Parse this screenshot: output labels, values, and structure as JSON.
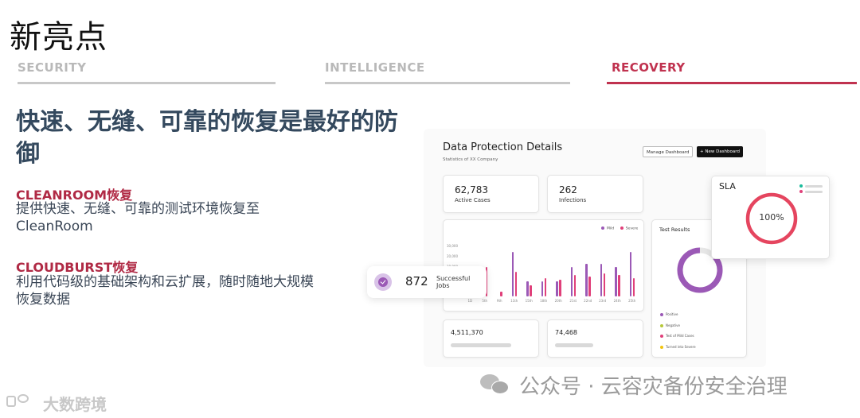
{
  "page_title": "新亮点",
  "tabs": [
    {
      "label": "SECURITY"
    },
    {
      "label": "INTELLIGENCE"
    },
    {
      "label": "RECOVERY"
    }
  ],
  "headline": "快速、无缝、可靠的恢复是最好的防御",
  "features": [
    {
      "title": "CLEANROOM恢复",
      "desc": "提供快速、无缝、可靠的测试环境恢复至CleanRoom"
    },
    {
      "title": "CLOUDBURST恢复",
      "desc": "利用代码级的基础架构和云扩展，随时随地大规模恢复数据"
    }
  ],
  "dashboard": {
    "title": "Data Protection Details",
    "subtitle": "Statistics of XX Company",
    "manage_button": "Manage Dashboard",
    "new_button": "+ New Dashboard",
    "active_cases_value": "62,783",
    "active_cases_label": "Active Cases",
    "infections_value": "262",
    "infections_label": "Infections",
    "bar_legend": [
      "Mild",
      "Severe"
    ],
    "bar_y_labels": [
      "30,000",
      "20,000",
      "10,000",
      "0"
    ],
    "bar_x_labels": [
      "1D",
      "5th",
      "9th",
      "11th",
      "15th",
      "18th",
      "20th",
      "21st",
      "22nd",
      "23rd",
      "24th",
      "25th"
    ],
    "test_results_title": "Test Results",
    "test_results_legend": [
      "Positive",
      "Negative",
      "Test of Mild Cases",
      "Turned into Severe"
    ],
    "bottom_value_1": "4,511,370",
    "bottom_value_2": "74,468",
    "sla_title": "SLA",
    "sla_value": "100%",
    "jobs_value": "872",
    "jobs_label": "Successful Jobs"
  },
  "chart_data": {
    "type": "bar",
    "categories": [
      "1D",
      "5th",
      "9th",
      "11th",
      "15th",
      "18th",
      "20th",
      "21st",
      "22nd",
      "23rd",
      "24th",
      "25th"
    ],
    "series": [
      {
        "name": "Mild",
        "values": [
          0,
          9000,
          0,
          27000,
          9000,
          9000,
          9000,
          18000,
          20000,
          20000,
          18000,
          27000
        ]
      },
      {
        "name": "Severe",
        "values": [
          0,
          18000,
          3000,
          15000,
          7000,
          11000,
          10000,
          13000,
          12000,
          14000,
          13000,
          11000
        ]
      }
    ],
    "ylim": [
      0,
      30000
    ],
    "xlabel": "",
    "ylabel": ""
  },
  "colors": {
    "accent": "#c0324f",
    "headline": "#34495e",
    "purple": "#9b59b6",
    "pink": "#e0407a",
    "ring_red": "#e5455f"
  },
  "watermark": {
    "text": "公众号 · 云容灾备份安全治理",
    "logo_text": "大数跨境"
  }
}
